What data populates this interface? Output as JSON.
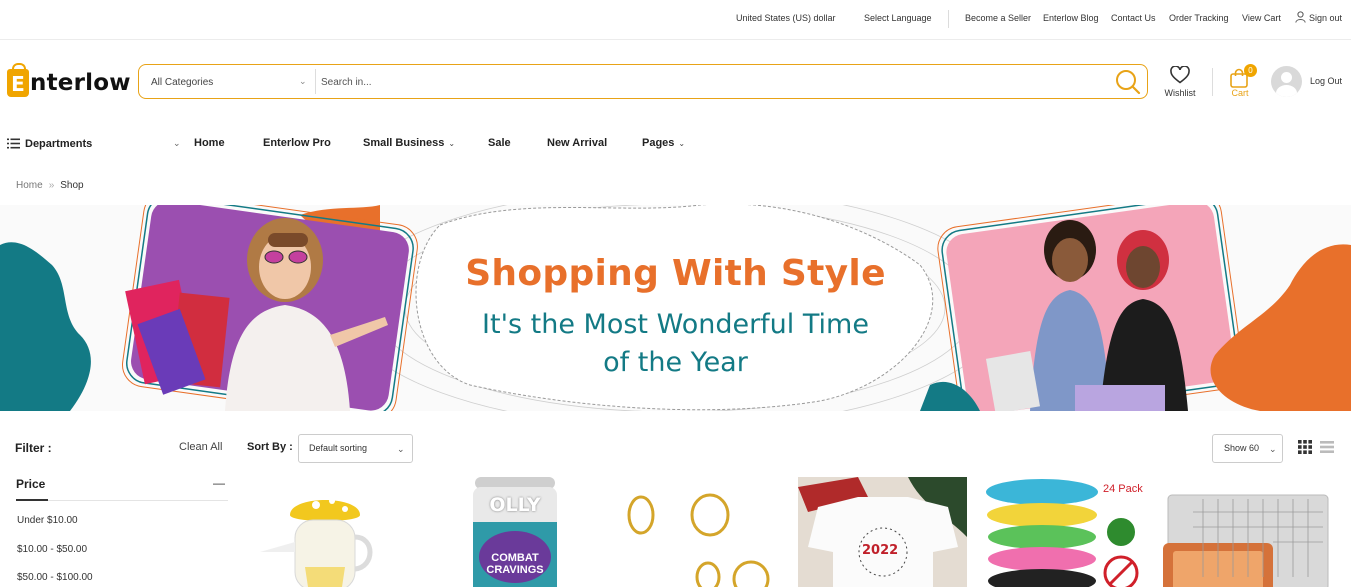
{
  "topbar": {
    "currency": "United States (US) dollar",
    "language": "Select Language",
    "links": [
      "Become a Seller",
      "Enterlow Blog",
      "Contact Us",
      "Order Tracking",
      "View Cart",
      "Sign out"
    ]
  },
  "header": {
    "logo_letter": "E",
    "logo_text": "nterlow",
    "search": {
      "category": "All Categories",
      "placeholder": "Search in..."
    },
    "wishlist_label": "Wishlist",
    "cart_label": "Cart",
    "cart_count": "0",
    "logout_label": "Log Out"
  },
  "nav": {
    "departments": "Departments",
    "items": [
      "Home",
      "Enterlow Pro",
      "Small Business",
      "Sale",
      "New Arrival",
      "Pages"
    ]
  },
  "breadcrumb": {
    "home": "Home",
    "sep": "»",
    "current": "Shop"
  },
  "banner": {
    "title": "Shopping With Style",
    "subtitle_line1": "It's the Most Wonderful Time",
    "subtitle_line2": "of the Year"
  },
  "filter": {
    "label": "Filter :",
    "clear": "Clean All",
    "price_heading": "Price",
    "price_options": [
      "Under $10.00",
      "$10.00 - $50.00",
      "$50.00 - $100.00"
    ]
  },
  "toolbar": {
    "sort_label": "Sort By :",
    "sort_value": "Default sorting",
    "show_value": "Show 60"
  },
  "products": {
    "olly_brand": "OLLY",
    "olly_name": "COMBAT CRAVINGS",
    "bracelet_pack": "24 Pack",
    "shirt_year": "2022"
  },
  "colors": {
    "accent": "#f0a500",
    "banner_title": "#e8702b",
    "banner_subtitle": "#137a85"
  }
}
